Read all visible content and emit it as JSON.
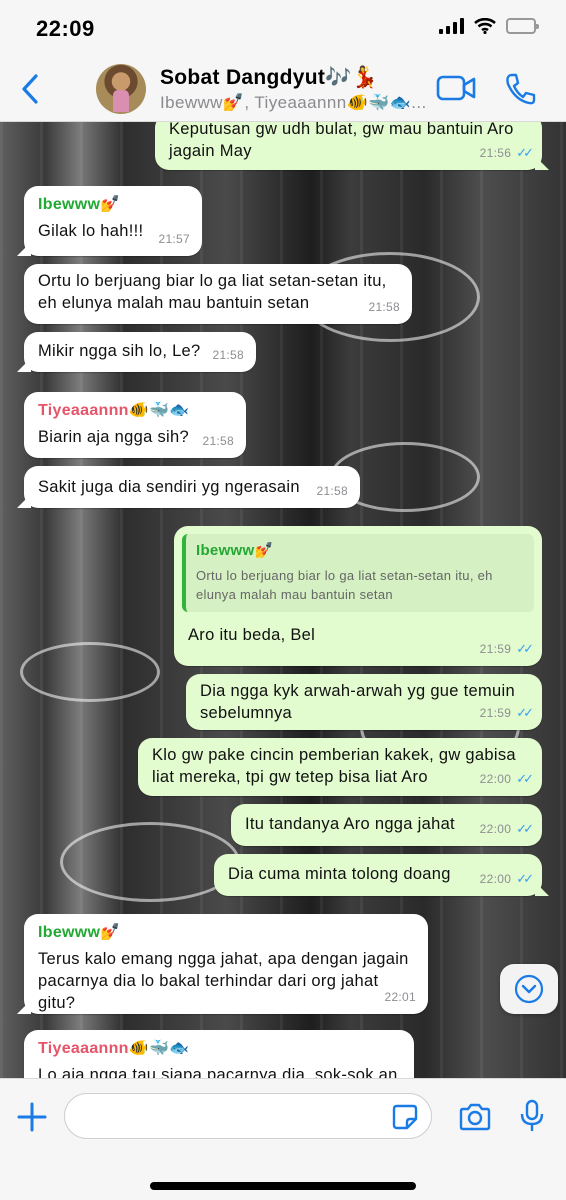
{
  "status_bar": {
    "time": "22:09"
  },
  "header": {
    "title": "Sobat Dangdyut🎶💃",
    "subtitle": "Ibewww💅, Tiyeaaannn🐠🐳🐟..."
  },
  "colors": {
    "accent": "#1a7be6",
    "outgoing": "#e2fbcf",
    "incoming": "#ffffff",
    "read_ticks": "#3aa0ef",
    "sender_green": "#23a833",
    "sender_red": "#e6546a"
  },
  "messages": [
    {
      "dir": "out",
      "text": "Keputusan gw udh bulat, gw mau bantuin Aro jagain May",
      "time": "21:56",
      "ticks": "✓✓"
    },
    {
      "dir": "in",
      "sender": "Ibewww💅",
      "text": "Gilak lo hah!!!",
      "time": "21:57"
    },
    {
      "dir": "in",
      "text": "Ortu lo berjuang biar lo ga liat setan-setan itu, eh elunya malah mau bantuin setan",
      "time": "21:58"
    },
    {
      "dir": "in",
      "text": "Mikir ngga sih lo, Le?",
      "time": "21:58"
    },
    {
      "dir": "in",
      "sender": "Tiyeaaannn🐠🐳🐟",
      "text": "Biarin aja ngga sih?",
      "time": "21:58"
    },
    {
      "dir": "in",
      "text": "Sakit juga dia sendiri yg ngerasain",
      "time": "21:58"
    },
    {
      "dir": "out",
      "quote_name": "Ibewww💅",
      "quote_text": "Ortu lo berjuang biar lo ga liat setan-setan itu, eh elunya malah mau bantuin setan",
      "text": "Aro itu beda, Bel",
      "time": "21:59",
      "ticks": "✓✓"
    },
    {
      "dir": "out",
      "text": "Dia ngga kyk arwah-arwah yg gue temuin sebelumnya",
      "time": "21:59",
      "ticks": "✓✓"
    },
    {
      "dir": "out",
      "text": "Klo gw pake cincin pemberian kakek, gw gabisa liat mereka, tpi gw tetep bisa liat Aro",
      "time": "22:00",
      "ticks": "✓✓"
    },
    {
      "dir": "out",
      "text": "Itu tandanya Aro ngga jahat",
      "time": "22:00",
      "ticks": "✓✓"
    },
    {
      "dir": "out",
      "text": "Dia cuma minta tolong doang",
      "time": "22:00",
      "ticks": "✓✓"
    },
    {
      "dir": "in",
      "sender": "Ibewww💅",
      "text": "Terus kalo emang ngga jahat, apa dengan jagain pacarnya dia lo bakal terhindar dari org jahat gitu?",
      "time": "22:01"
    },
    {
      "dir": "in",
      "sender": "Tiyeaaannn🐠🐳🐟",
      "text": "Lo aja ngga tau siapa pacarnya dia, sok-sok an"
    }
  ],
  "composer": {
    "value": "",
    "placeholder": ""
  },
  "icons": [
    "back-chevron-icon",
    "video-call-icon",
    "phone-icon",
    "chevron-down-icon",
    "plus-icon",
    "sticker-icon",
    "camera-icon",
    "microphone-icon"
  ]
}
